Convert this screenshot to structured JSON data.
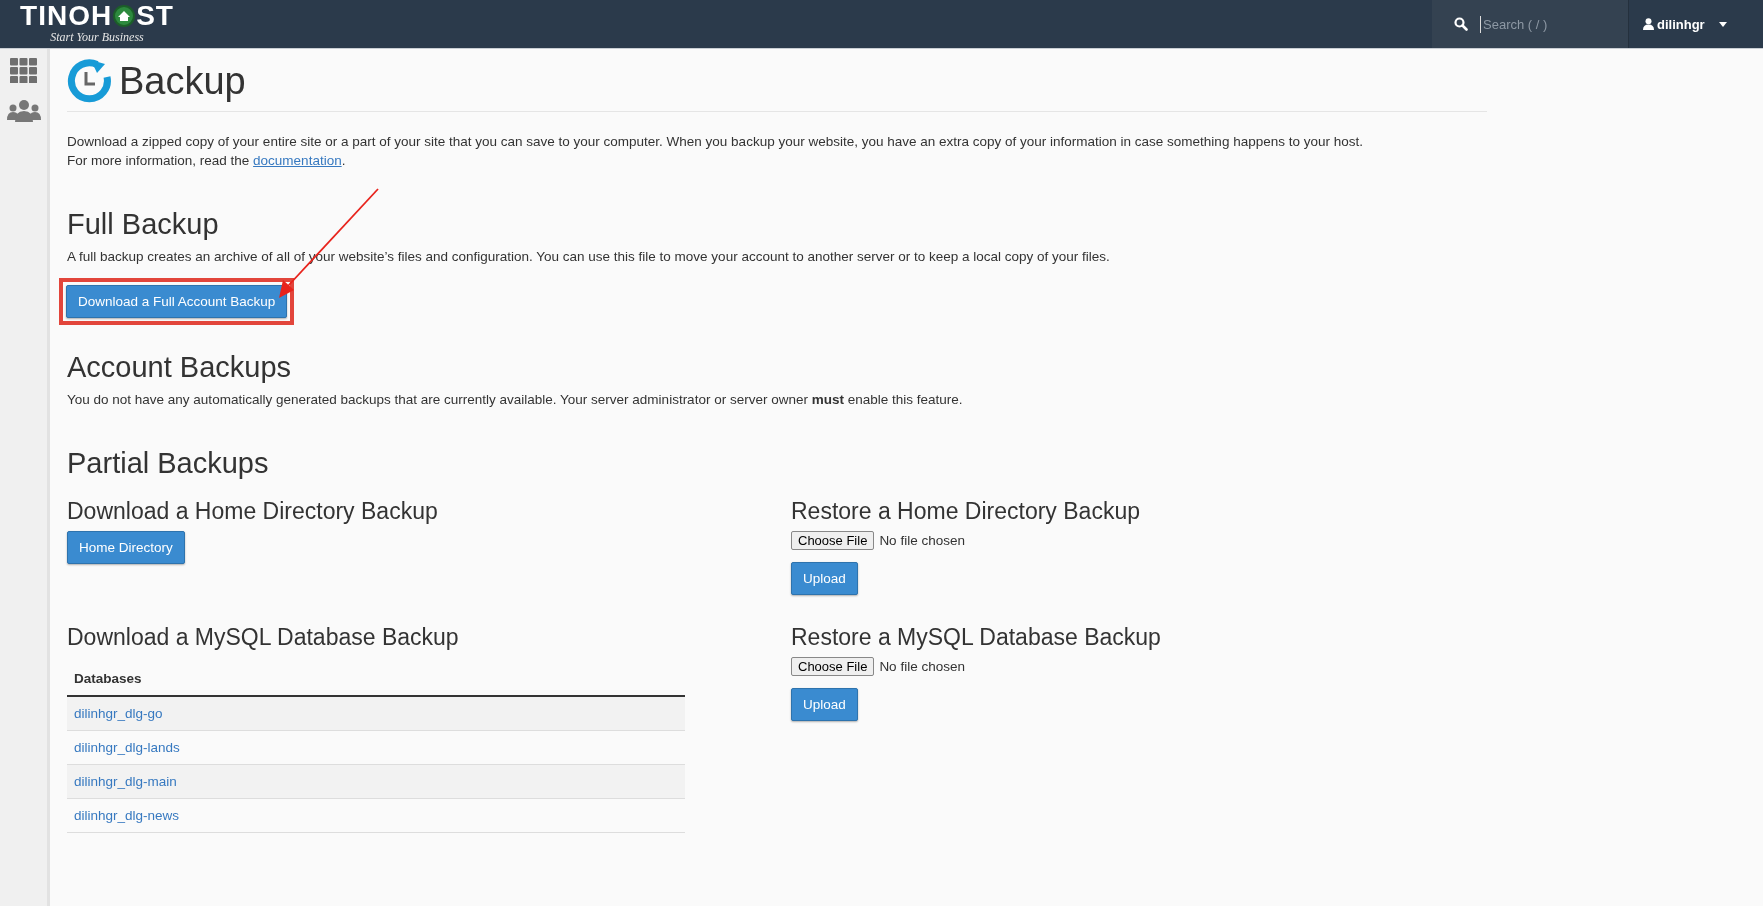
{
  "header": {
    "logo": {
      "left": "TINOH",
      "right": "ST",
      "tagline": "Start Your Business"
    },
    "search": {
      "placeholder": "Search ( / )"
    },
    "user": {
      "name": "dilinhgr"
    }
  },
  "sidebar": {
    "items": [
      {
        "kind": "apps"
      },
      {
        "kind": "users"
      }
    ]
  },
  "page": {
    "title": "Backup",
    "intro": "Download a zipped copy of your entire site or a part of your site that you can save to your computer. When you backup your website, you have an extra copy of your information in case something happens to your host.",
    "intro_more": "For more information, read the",
    "intro_link": "documentation",
    "intro_end": "."
  },
  "full_backup": {
    "heading": "Full Backup",
    "text": "A full backup creates an archive of all of your website’s files and configuration. You can use this file to move your account to another server or to keep a local copy of your files.",
    "button": {
      "label": "Download a Full Account Backup",
      "highlighted": true
    }
  },
  "account_backups": {
    "heading": "Account Backups",
    "text": "You do not have any automatically generated backups that are currently available. Your server administrator or server owner **must** enable this feature."
  },
  "partial_backups": {
    "heading": "Partial Backups",
    "home_download": {
      "heading": "Download a Home Directory Backup",
      "button": "Home Directory"
    },
    "home_restore": {
      "heading": "Restore a Home Directory Backup",
      "file_button": "Choose File",
      "file_status": "No file chosen",
      "button": "Upload"
    },
    "mysql_download": {
      "heading": "Download a MySQL Database Backup",
      "table": {
        "columns": [
          "Databases"
        ],
        "rows": [
          {
            "name": "dilinhgr_dlg-go"
          },
          {
            "name": "dilinhgr_dlg-lands"
          },
          {
            "name": "dilinhgr_dlg-main"
          },
          {
            "name": "dilinhgr_dlg-news"
          }
        ]
      }
    },
    "mysql_restore": {
      "heading": "Restore a MySQL Database Backup",
      "file_button": "Choose File",
      "file_status": "No file chosen",
      "button": "Upload"
    }
  }
}
